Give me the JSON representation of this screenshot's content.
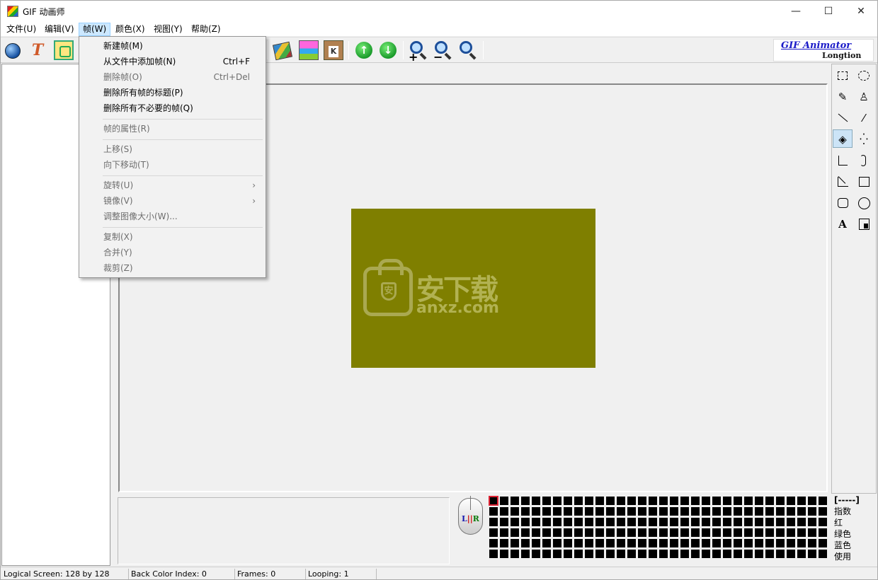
{
  "window": {
    "title": "GIF 动画师",
    "minimize": "—",
    "maximize": "☐",
    "close": "✕"
  },
  "menubar": {
    "items": [
      {
        "label": "文件(U)"
      },
      {
        "label": "编辑(V)"
      },
      {
        "label": "帧(W)"
      },
      {
        "label": "颜色(X)"
      },
      {
        "label": "视图(Y)"
      },
      {
        "label": "帮助(Z)"
      }
    ]
  },
  "toolbar": {
    "up_glyph": "↑",
    "down_glyph": "↓",
    "zoom_in_sym": "+",
    "zoom_out_sym": "−",
    "brand_line1": "GIF Animator",
    "brand_line2": "Longtion"
  },
  "canvas": {
    "color": "#7f7f00",
    "watermark_big": "安下载",
    "watermark_small": "anxz.com",
    "watermark_shield": "安"
  },
  "tools": {
    "text_tool": "A"
  },
  "mouse": {
    "l": "L",
    "mid": "||",
    "r": "R"
  },
  "color_info": {
    "header": "[-----]",
    "index": "指数",
    "red": "红",
    "green": "绿色",
    "blue": "蓝色",
    "use": "使用"
  },
  "statusbar": {
    "logical_screen": "Logical Screen: 128 by 128",
    "back_color": "Back Color Index: 0",
    "frames": "Frames: 0",
    "looping": "Looping: 1"
  },
  "frame_menu": {
    "new_frame": "新建帧(M)",
    "add_from_file": "从文件中添加帧(N)",
    "add_from_file_shortcut": "Ctrl+F",
    "delete_frame": "删除帧(O)",
    "delete_frame_shortcut": "Ctrl+Del",
    "delete_all_titles": "删除所有帧的标题(P)",
    "delete_unneeded": "删除所有不必要的帧(Q)",
    "properties": "帧的属性(R)",
    "move_up": "上移(S)",
    "move_down": "向下移动(T)",
    "rotate": "旋转(U)",
    "mirror": "镜像(V)",
    "resize": "调整图像大小(W)...",
    "copy": "复制(X)",
    "merge": "合并(Y)",
    "crop": "裁剪(Z)",
    "submenu_arrow": "›"
  },
  "icons": {
    "app": "gif-animator-app-icon",
    "open": "globe-icon",
    "text": "text-icon",
    "frame": "frame-icon",
    "film": "film-icon",
    "pictures": "pictures-icon",
    "clipboard": "clipboard-icon",
    "up": "move-up-icon",
    "down": "move-down-icon",
    "zoom_in": "zoom-in-icon",
    "zoom_out": "zoom-out-icon",
    "zoom_reset": "zoom-icon"
  }
}
